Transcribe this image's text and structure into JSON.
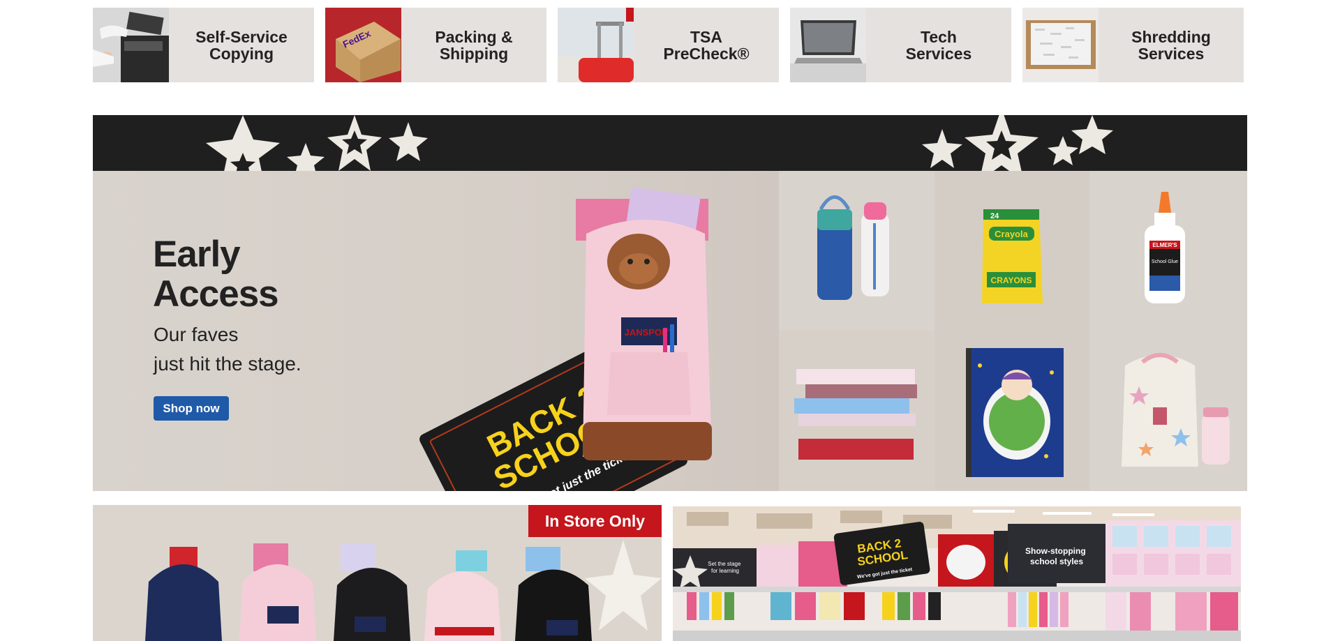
{
  "services": [
    {
      "label": "Self-Service\nCopying",
      "icon": "copier-icon"
    },
    {
      "label": "Packing &\nShipping",
      "icon": "package-icon"
    },
    {
      "label": "TSA\nPreCheck®",
      "icon": "luggage-icon"
    },
    {
      "label": "Tech\nServices",
      "icon": "laptop-icon"
    },
    {
      "label": "Shredding\nServices",
      "icon": "shred-box-icon"
    }
  ],
  "hero": {
    "title_line1": "Early",
    "title_line2": "Access",
    "subtitle": "Our faves\njust hit the stage.",
    "cta_label": "Shop now",
    "ticket_text": "BACK 2\nSCHOOL",
    "ticket_tagline": "We've got just the ticket",
    "backpack_brand": "JANSPORT",
    "crayon_brand": "Crayola",
    "crayon_label": "CRAYONS",
    "crayon_count": "24",
    "glue_brand": "ELMER'S",
    "glue_label": "School Glue",
    "accent_color": "#1f5aa8"
  },
  "promos": {
    "left_badge": "In Store Only",
    "right_store_sign": "BACK 2\nSCHOOL",
    "right_store_sign_tag": "We've got just the ticket",
    "right_panel_text": "Show-stopping\nschool styles",
    "right_small_text": "Set the stage\nfor learning"
  }
}
